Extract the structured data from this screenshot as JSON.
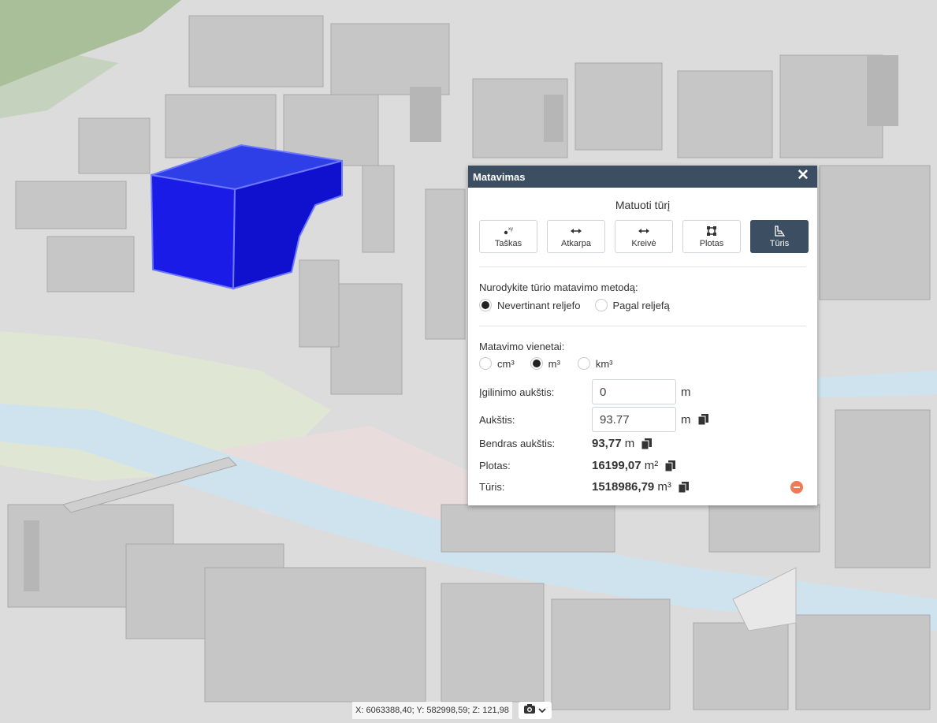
{
  "panel": {
    "title": "Matavimas",
    "subtitle": "Matuoti tūrį",
    "tools": [
      {
        "label": "Taškas",
        "icon": "point-xy-icon",
        "active": false
      },
      {
        "label": "Atkarpa",
        "icon": "segment-arrow-icon",
        "active": false
      },
      {
        "label": "Kreivė",
        "icon": "curve-arrow-icon",
        "active": false
      },
      {
        "label": "Plotas",
        "icon": "area-icon",
        "active": false
      },
      {
        "label": "Tūris",
        "icon": "volume-icon",
        "active": true
      }
    ],
    "method": {
      "label": "Nurodykite tūrio matavimo metodą:",
      "options": [
        "Nevertinant reljefo",
        "Pagal reljefą"
      ],
      "selected": "Nevertinant reljefo"
    },
    "units": {
      "label": "Matavimo vienetai:",
      "options": [
        "cm³",
        "m³",
        "km³"
      ],
      "selected": "m³"
    },
    "fields": {
      "depth": {
        "label": "Įgilinimo aukštis:",
        "value": "0",
        "unit": "m"
      },
      "height": {
        "label": "Aukštis:",
        "value": "93.77",
        "unit": "m"
      }
    },
    "results": {
      "total_height": {
        "label": "Bendras aukštis:",
        "value": "93,77",
        "unit": "m"
      },
      "area": {
        "label": "Plotas:",
        "value": "16199,07",
        "unit": "m²"
      },
      "volume": {
        "label": "Tūris:",
        "value": "1518986,79",
        "unit": "m³"
      }
    }
  },
  "status": {
    "coords": "X: 6063388,40; Y: 582998,59; Z: 121,98"
  },
  "colors": {
    "header": "#3b4e62",
    "volume_box": "#1010e6",
    "remove": "#f07a55",
    "river": "#cfe3ee"
  }
}
